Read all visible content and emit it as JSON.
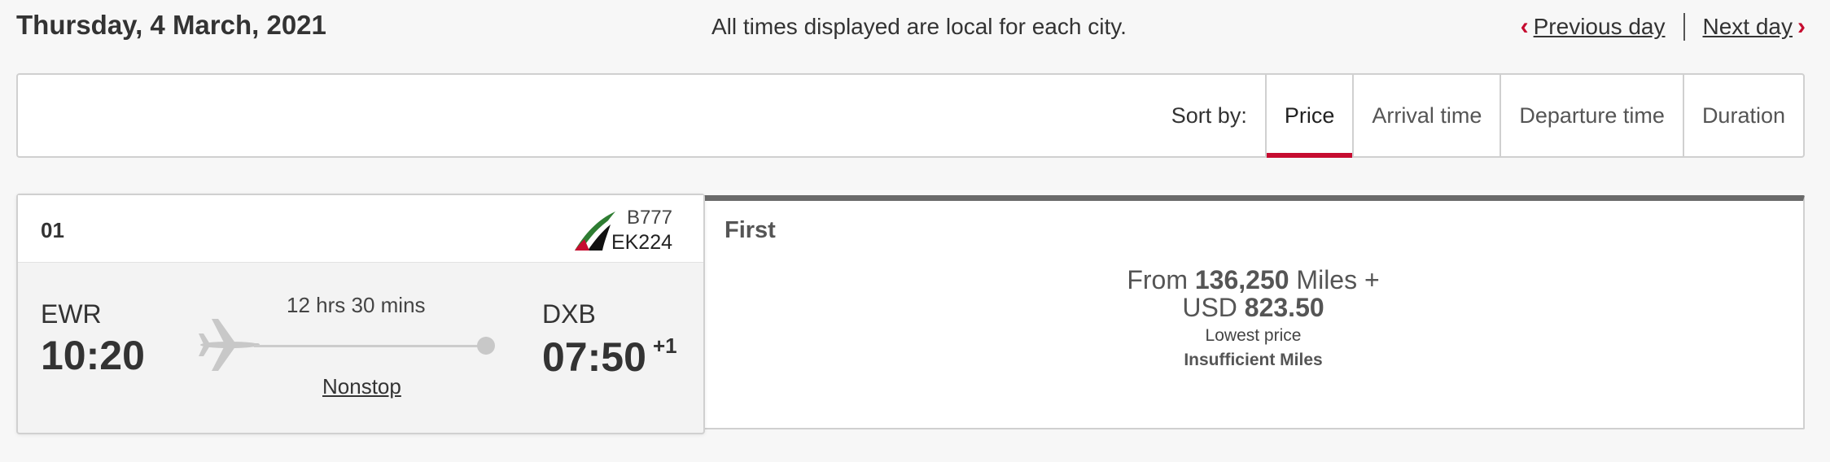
{
  "header": {
    "date": "Thursday, 4 March, 2021",
    "times_note": "All times displayed are local for each city.",
    "previous_day": "Previous day",
    "next_day": "Next day"
  },
  "sort": {
    "label": "Sort by:",
    "options": [
      "Price",
      "Arrival time",
      "Departure time",
      "Duration"
    ],
    "active": "Price"
  },
  "flight": {
    "number": "01",
    "aircraft": "B777",
    "flight_code": "EK224",
    "origin_code": "EWR",
    "departure_time": "10:20",
    "destination_code": "DXB",
    "arrival_time": "07:50",
    "day_offset": "+1",
    "duration": "12 hrs 30 mins",
    "stops": "Nonstop"
  },
  "fare": {
    "cabin": "First",
    "from_label": "From",
    "miles": "136,250",
    "miles_label": "Miles +",
    "currency": "USD",
    "cash": "823.50",
    "lowest_label": "Lowest price",
    "status": "Insufficient Miles"
  },
  "colors": {
    "accent": "#c60c30",
    "cabin_bar": "#6a6a6a"
  },
  "icons": [
    "chevron-left-icon",
    "chevron-right-icon",
    "airline-logo",
    "plane-icon"
  ]
}
